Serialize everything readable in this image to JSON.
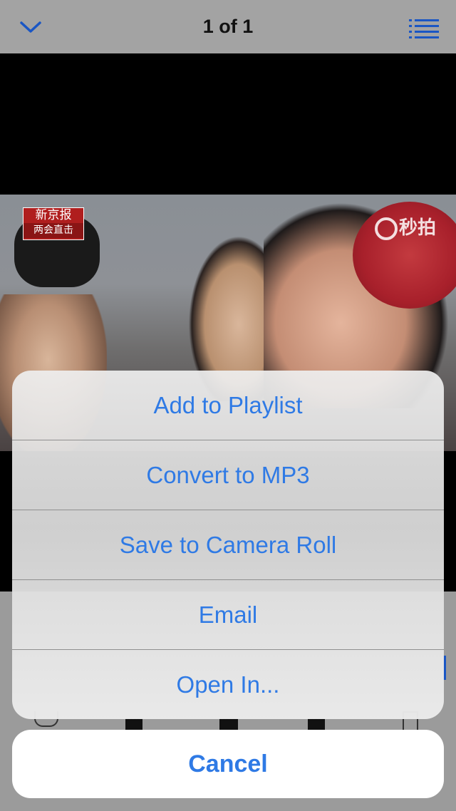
{
  "header": {
    "title": "1 of 1",
    "collapse_icon": "chevron-down-icon",
    "list_icon": "list-icon"
  },
  "video": {
    "channel_logo_line1": "新京报",
    "channel_logo_line2": "两会直击",
    "watermark": "秒拍"
  },
  "action_sheet": {
    "items": [
      {
        "label": "Add to Playlist"
      },
      {
        "label": "Convert to MP3"
      },
      {
        "label": "Save to Camera Roll"
      },
      {
        "label": "Email"
      },
      {
        "label": "Open In..."
      }
    ],
    "cancel_label": "Cancel"
  },
  "colors": {
    "accent": "#2f7ae5",
    "overlay": "#9b9b9b",
    "sheet_bg": "#e6e6e6"
  }
}
